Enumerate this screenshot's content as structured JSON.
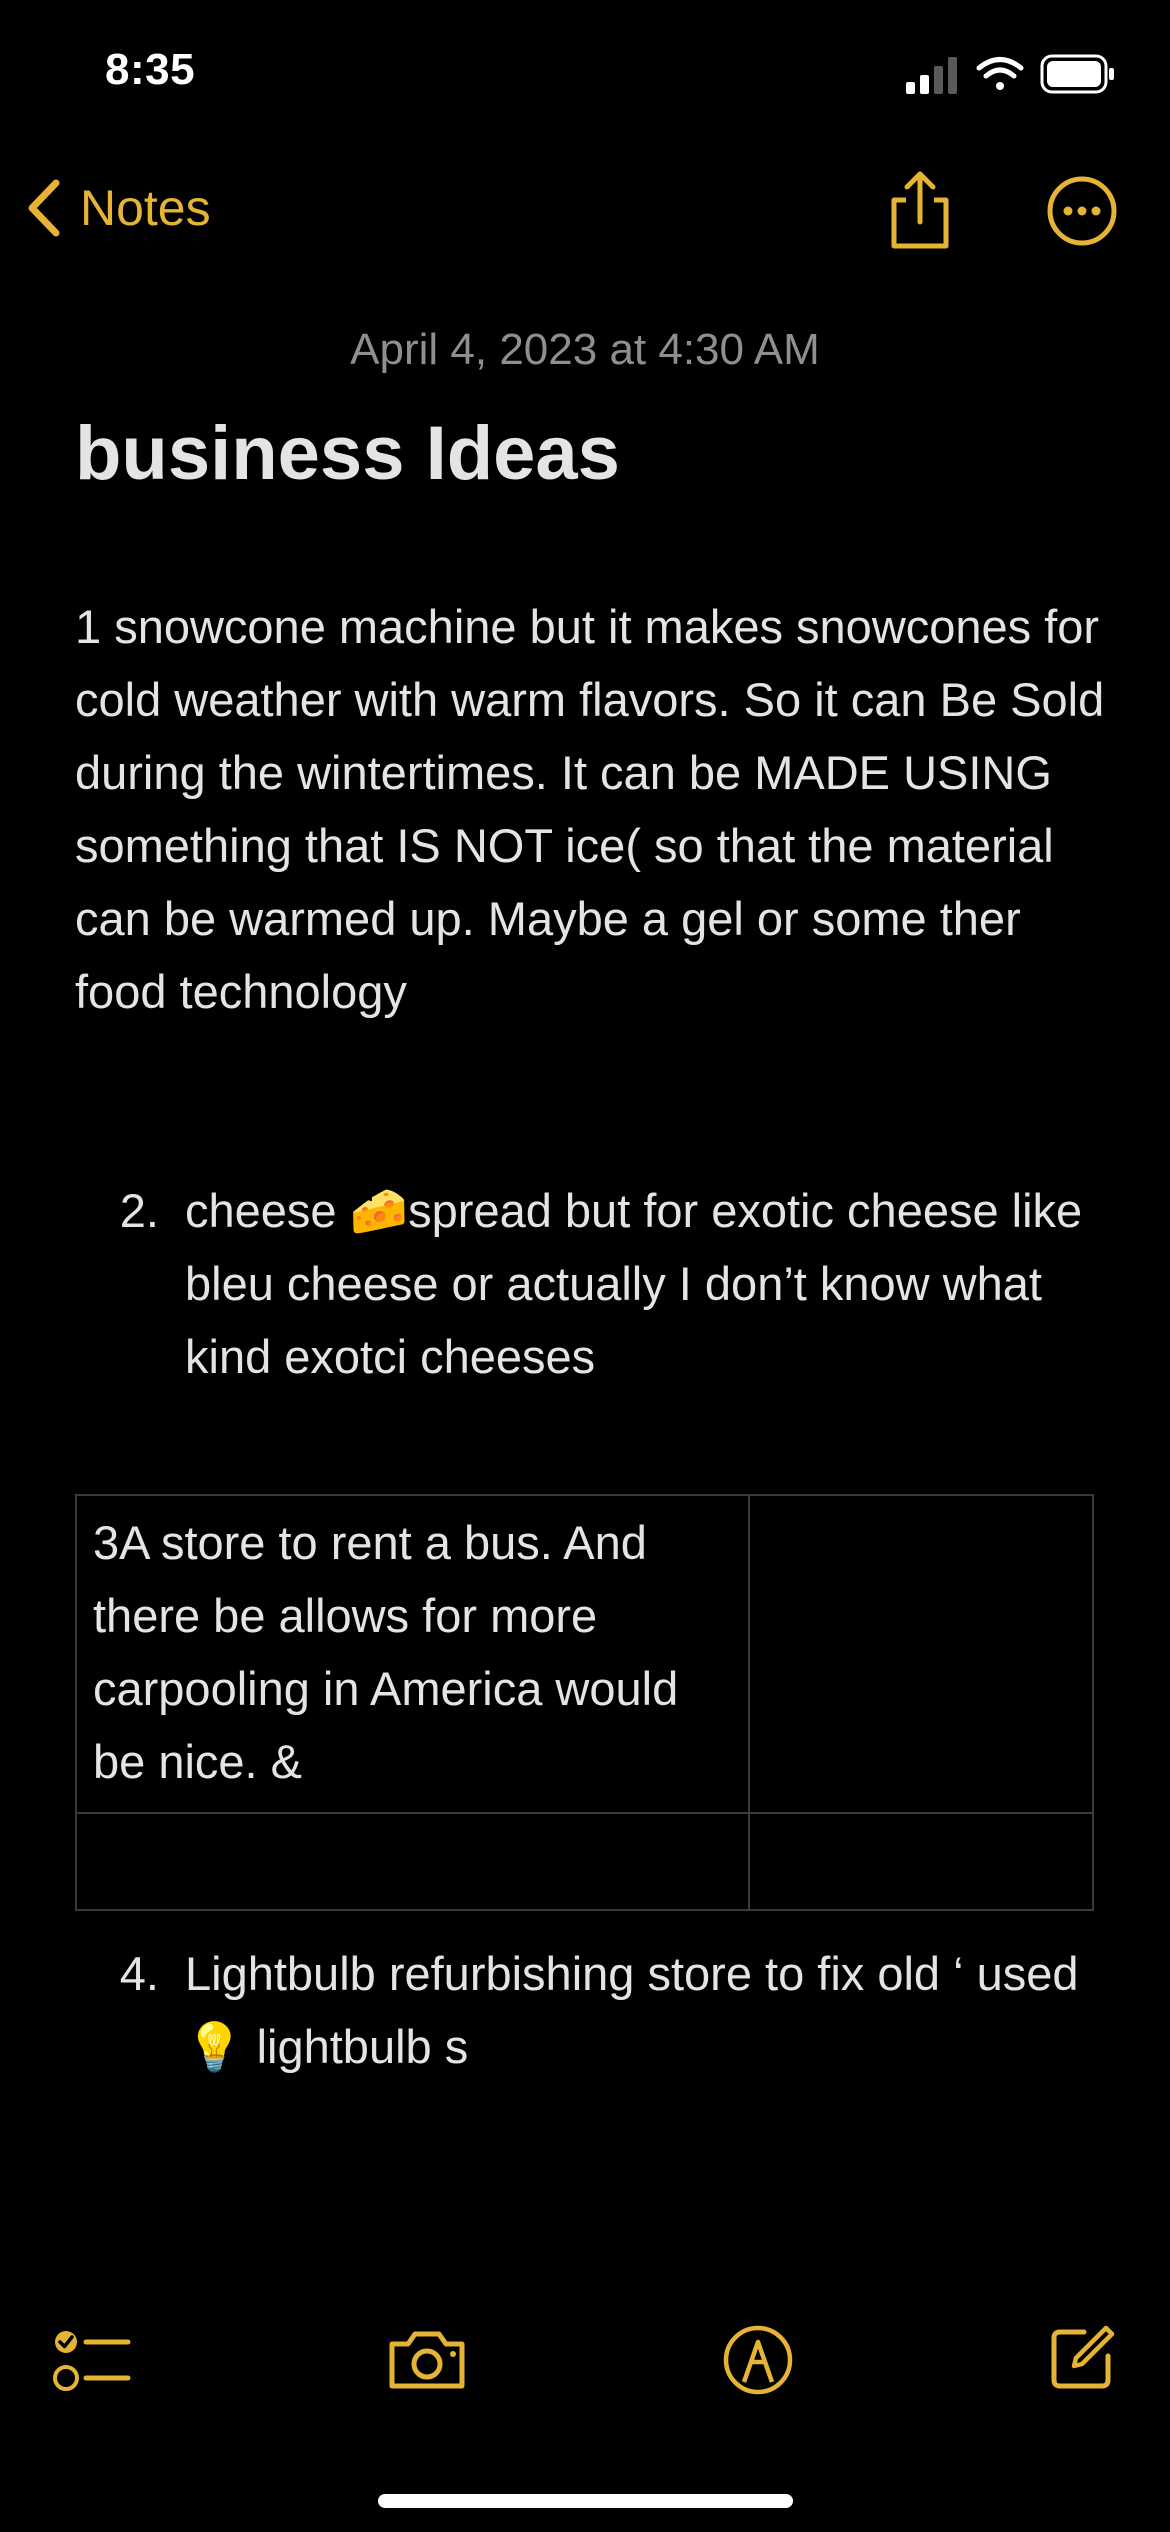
{
  "status_bar": {
    "time": "8:35"
  },
  "nav": {
    "back_label": "Notes",
    "back_icon": "chevron-left-icon",
    "share_icon": "share-icon",
    "more_icon": "ellipsis-circle-icon"
  },
  "note": {
    "date": "April 4, 2023 at 4:30 AM",
    "title": "business Ideas",
    "paragraph1": "1 snowcone machine but it makes snowcones for cold weather with warm flavors. So it can Be Sold during the wintertimes. It can be MADE USING something that IS NOT ice( so that the material can be warmed up. Maybe a gel or some ther food technology",
    "item2": {
      "number": "2.",
      "text_before": "cheese ",
      "emoji": "🧀",
      "text_after": "spread but for exotic cheese like bleu cheese or actually I don’t know what kind exotci cheeses"
    },
    "table": {
      "rows": [
        [
          "3A store to rent a bus. And there be allows for more carpooling in America would be nice. &",
          ""
        ],
        [
          "",
          ""
        ]
      ]
    },
    "item4": {
      "number": "4.",
      "text_before": "Lightbulb refurbishing store to fix old ‘ used ",
      "emoji": "💡",
      "text_after": " lightbulb s"
    }
  },
  "toolbar": {
    "checklist_icon": "checklist-icon",
    "camera_icon": "camera-icon",
    "markup_icon": "markup-pen-icon",
    "compose_icon": "compose-icon"
  },
  "colors": {
    "accent": "#e6b434",
    "background": "#000000",
    "text": "#e4e4e4",
    "secondary_text": "#8e8e93",
    "table_border": "#3a3a3c"
  }
}
